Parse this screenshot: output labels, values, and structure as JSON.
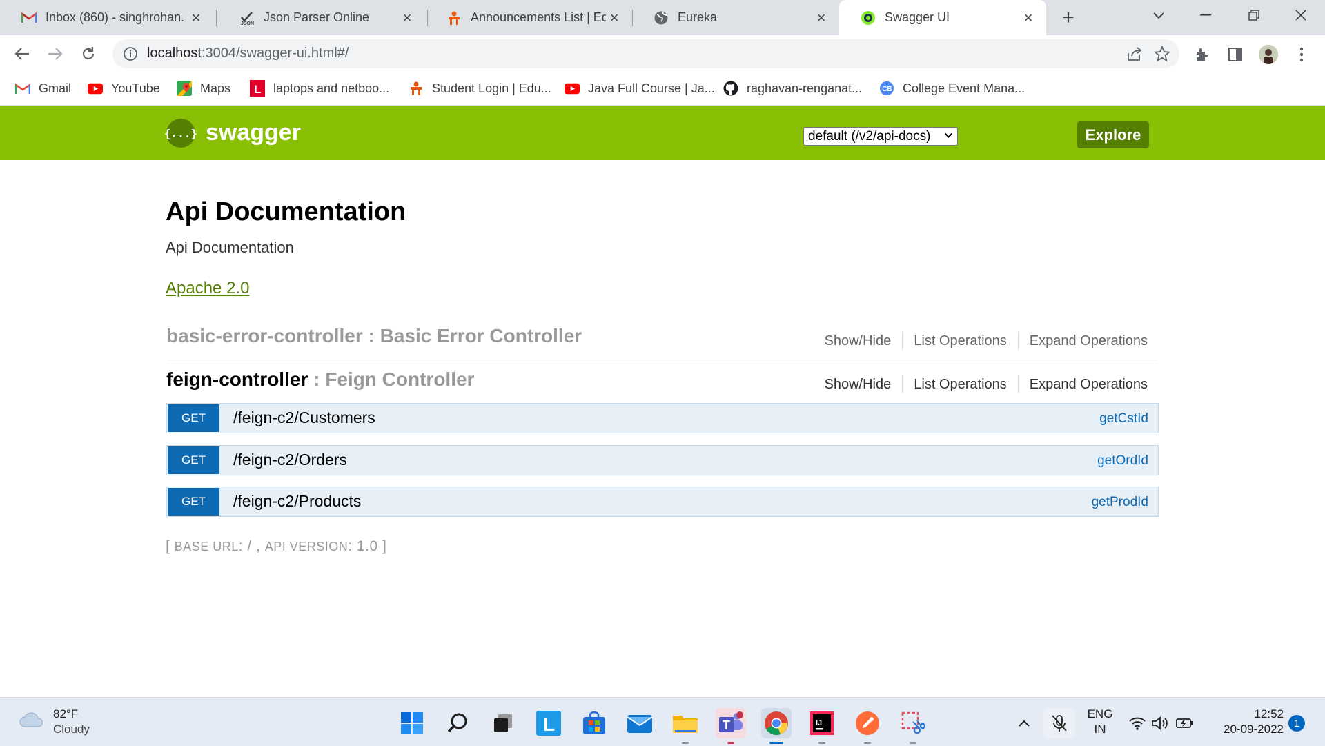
{
  "browser": {
    "tabs": [
      {
        "title": "Inbox (860) - singhrohan.",
        "icon": "gmail-icon",
        "active": false
      },
      {
        "title": "Json Parser Online",
        "icon": "json-icon",
        "active": false
      },
      {
        "title": "Announcements List | Edu",
        "icon": "edu-icon",
        "active": false
      },
      {
        "title": "Eureka",
        "icon": "globe-icon",
        "active": false
      },
      {
        "title": "Swagger UI",
        "icon": "swagger-icon",
        "active": true
      }
    ],
    "address": {
      "host": "localhost",
      "rest": ":3004/swagger-ui.html#/"
    },
    "bookmarks": [
      {
        "label": "Gmail",
        "icon": "gmail-icon"
      },
      {
        "label": "YouTube",
        "icon": "youtube-icon"
      },
      {
        "label": "Maps",
        "icon": "maps-icon"
      },
      {
        "label": "laptops and netboo...",
        "icon": "l-icon"
      },
      {
        "label": "Student Login | Edu...",
        "icon": "edu-icon"
      },
      {
        "label": "Java Full Course | Ja...",
        "icon": "youtube-icon"
      },
      {
        "label": "raghavan-renganat...",
        "icon": "github-icon"
      },
      {
        "label": "College Event Mana...",
        "icon": "cb-icon"
      }
    ]
  },
  "swagger": {
    "brand": "swagger",
    "logo_glyph": "{...}",
    "spec_select": "default (/v2/api-docs)",
    "explore_label": "Explore",
    "colors": {
      "header": "#89bf04",
      "dark_green": "#547f00",
      "get": "#0f6ab4"
    }
  },
  "api": {
    "title": "Api Documentation",
    "description": "Api Documentation",
    "license": "Apache 2.0"
  },
  "controllers": [
    {
      "name": "basic-error-controller",
      "sep": " : ",
      "desc": "Basic Error Controller",
      "ops": [
        "Show/Hide",
        "List Operations",
        "Expand Operations"
      ],
      "endpoints": []
    },
    {
      "name": "feign-controller",
      "sep": " : ",
      "desc": "Feign Controller",
      "ops": [
        "Show/Hide",
        "List Operations",
        "Expand Operations"
      ],
      "endpoints": [
        {
          "method": "GET",
          "path": "/feign-c2/Customers",
          "nickname": "getCstId"
        },
        {
          "method": "GET",
          "path": "/feign-c2/Orders",
          "nickname": "getOrdId"
        },
        {
          "method": "GET",
          "path": "/feign-c2/Products",
          "nickname": "getProdId"
        }
      ]
    }
  ],
  "footer": {
    "open": "[ ",
    "base_label": "Base URL",
    "base_value": ": / , ",
    "version_label": "Api Version",
    "version_value": ": 1.0",
    "close": " ]"
  },
  "taskbar": {
    "weather": {
      "temp": "82°F",
      "cond": "Cloudy"
    },
    "apps": [
      "start-icon",
      "search-icon",
      "task-view-icon",
      "l-app-icon",
      "store-icon",
      "mail-icon",
      "file-explorer-icon",
      "teams-icon",
      "chrome-icon",
      "intellij-icon",
      "postman-icon",
      "snipping-tool-icon"
    ],
    "lang": {
      "line1": "ENG",
      "line2": "IN"
    },
    "time": "12:52",
    "date": "20-09-2022",
    "notifications": "1"
  }
}
